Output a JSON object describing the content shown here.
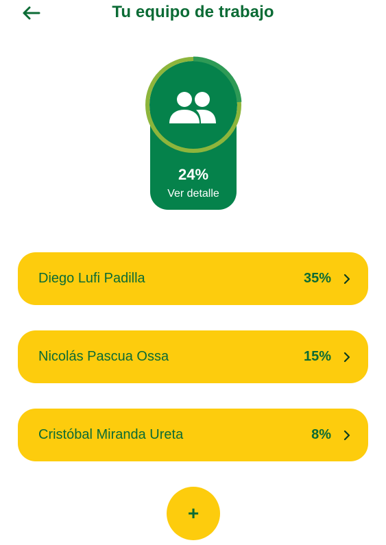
{
  "header": {
    "title": "Tu equipo de trabajo",
    "back_icon": "arrow-left-icon"
  },
  "summary": {
    "icon": "team-icon",
    "progress": 0.24,
    "percent_label": "24%",
    "detail_label": "Ver detalle"
  },
  "members": [
    {
      "name": "Diego Lufi Padilla",
      "percent": "35%"
    },
    {
      "name": "Nicolás Pascua Ossa",
      "percent": "15%"
    },
    {
      "name": "Cristóbal Miranda Ureta",
      "percent": "8%"
    }
  ],
  "add_button": {
    "label": "+"
  },
  "colors": {
    "brand_green": "#0b6b35",
    "card_green": "#05824b",
    "ring_light": "#8db53c",
    "ring_progress": "#2e9a56",
    "accent_yellow": "#fdcc0d"
  }
}
